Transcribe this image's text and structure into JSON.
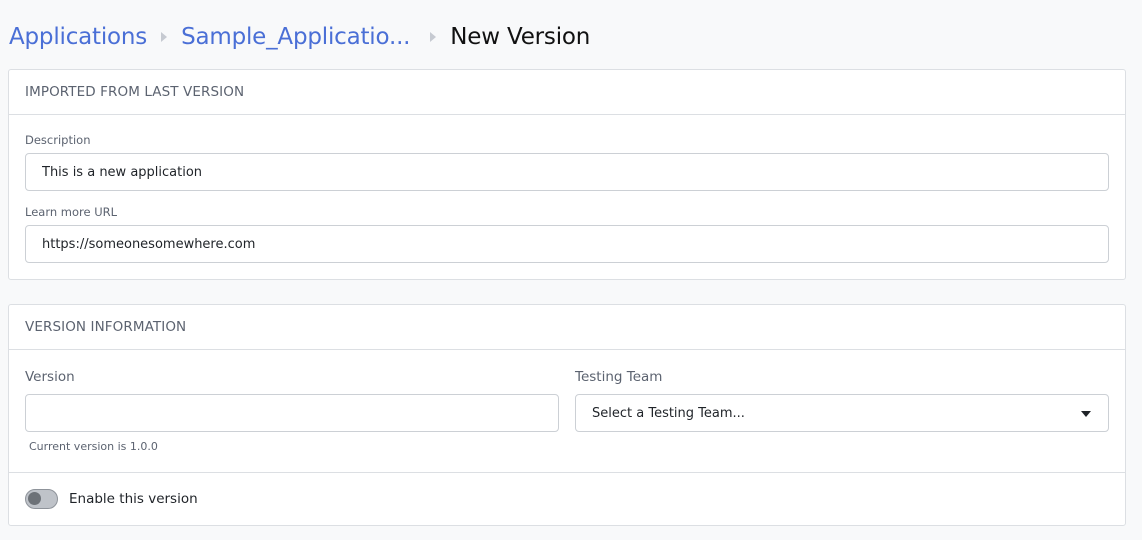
{
  "breadcrumb": {
    "items": [
      "Applications",
      "Sample_Applicatio..."
    ],
    "current": "New Version"
  },
  "imported_section": {
    "title": "IMPORTED FROM LAST VERSION",
    "description": {
      "label": "Description",
      "value": "This is a new application"
    },
    "learn_more_url": {
      "label": "Learn more URL",
      "value": "https://someonesomewhere.com"
    }
  },
  "version_section": {
    "title": "VERSION INFORMATION",
    "version": {
      "label": "Version",
      "value": "",
      "hint": "Current version is 1.0.0"
    },
    "testing_team": {
      "label": "Testing Team",
      "selected": "Select a Testing Team..."
    },
    "enable_toggle": {
      "label": "Enable this version",
      "checked": false
    }
  },
  "colors": {
    "link": "#4a6fd6",
    "border": "#dcdfe3",
    "background": "#f8f9fa"
  }
}
